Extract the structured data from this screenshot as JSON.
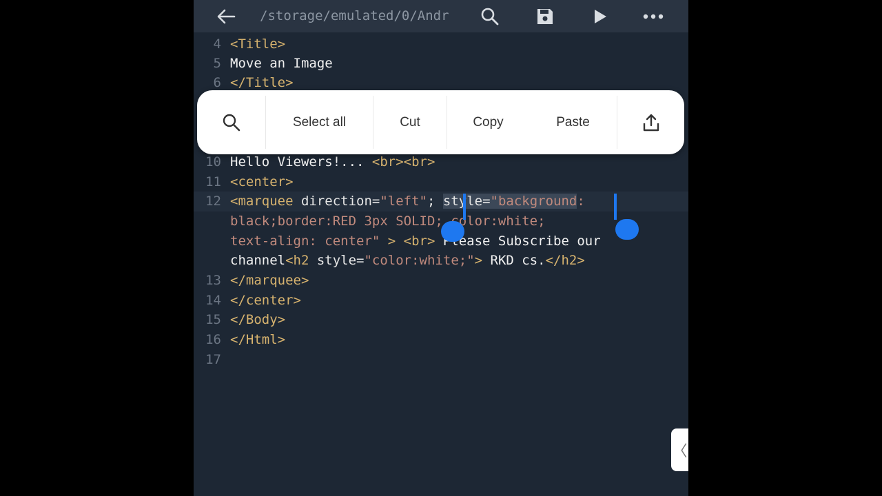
{
  "topbar": {
    "path": "/storage/emulated/0/Andr",
    "icons": [
      "back-arrow-icon",
      "search-icon",
      "save-icon",
      "run-icon",
      "more-icon"
    ]
  },
  "editor": {
    "lines": [
      {
        "num": "4",
        "segments": [
          {
            "c": "t",
            "text": "<Title>"
          }
        ]
      },
      {
        "num": "5",
        "segments": [
          {
            "c": "x",
            "text": "Move an Image"
          }
        ]
      },
      {
        "num": "6",
        "segments": [
          {
            "c": "t",
            "text": "</Title>"
          }
        ]
      },
      {
        "num": "10",
        "segments": [
          {
            "c": "x",
            "text": "Hello Viewers!... "
          },
          {
            "c": "t",
            "text": "<br><br>"
          }
        ]
      },
      {
        "num": "11",
        "segments": [
          {
            "c": "t",
            "text": "<center>"
          }
        ]
      },
      {
        "num": "12",
        "active": true,
        "segments": [
          {
            "c": "t",
            "text": "<marquee "
          },
          {
            "c": "a",
            "text": "direction="
          },
          {
            "c": "s",
            "text": "\"left\""
          },
          {
            "c": "a",
            "text": "; "
          },
          {
            "c": "a sel",
            "text": "style="
          },
          {
            "c": "s sel",
            "text": "\"background"
          },
          {
            "c": "s",
            "text": ":"
          }
        ]
      },
      {
        "num": "",
        "segments": [
          {
            "c": "s",
            "text": "black;border:RED 3px SOLID; color:white;"
          }
        ]
      },
      {
        "num": "",
        "segments": [
          {
            "c": "s",
            "text": "text-align: center\""
          },
          {
            "c": "t",
            "text": " > <br> "
          },
          {
            "c": "x",
            "text": "Please Subscribe our"
          }
        ]
      },
      {
        "num": "",
        "segments": [
          {
            "c": "x",
            "text": "channel"
          },
          {
            "c": "t",
            "text": "<h2 "
          },
          {
            "c": "a",
            "text": "style="
          },
          {
            "c": "s",
            "text": "\"color:white;\""
          },
          {
            "c": "t",
            "text": "> "
          },
          {
            "c": "x",
            "text": "RKD cs."
          },
          {
            "c": "t",
            "text": "</h2>"
          }
        ]
      },
      {
        "num": "13",
        "segments": [
          {
            "c": "t",
            "text": "</marquee>"
          }
        ]
      },
      {
        "num": "14",
        "segments": [
          {
            "c": "t",
            "text": "</center>"
          }
        ]
      },
      {
        "num": "15",
        "segments": [
          {
            "c": "t",
            "text": "</Body>"
          }
        ]
      },
      {
        "num": "16",
        "segments": [
          {
            "c": "t",
            "text": "</Html>"
          }
        ]
      },
      {
        "num": "17",
        "segments": []
      }
    ]
  },
  "context_menu": {
    "search_icon": "search-icon",
    "select_all": "Select all",
    "cut": "Cut",
    "copy": "Copy",
    "paste": "Paste",
    "share_icon": "share-icon"
  },
  "side_tab": {
    "glyph": "〈"
  },
  "colors": {
    "background": "#1d2734",
    "tag": "#d6b26e",
    "string": "#c18a7d",
    "selection_handle": "#1e78f0"
  }
}
